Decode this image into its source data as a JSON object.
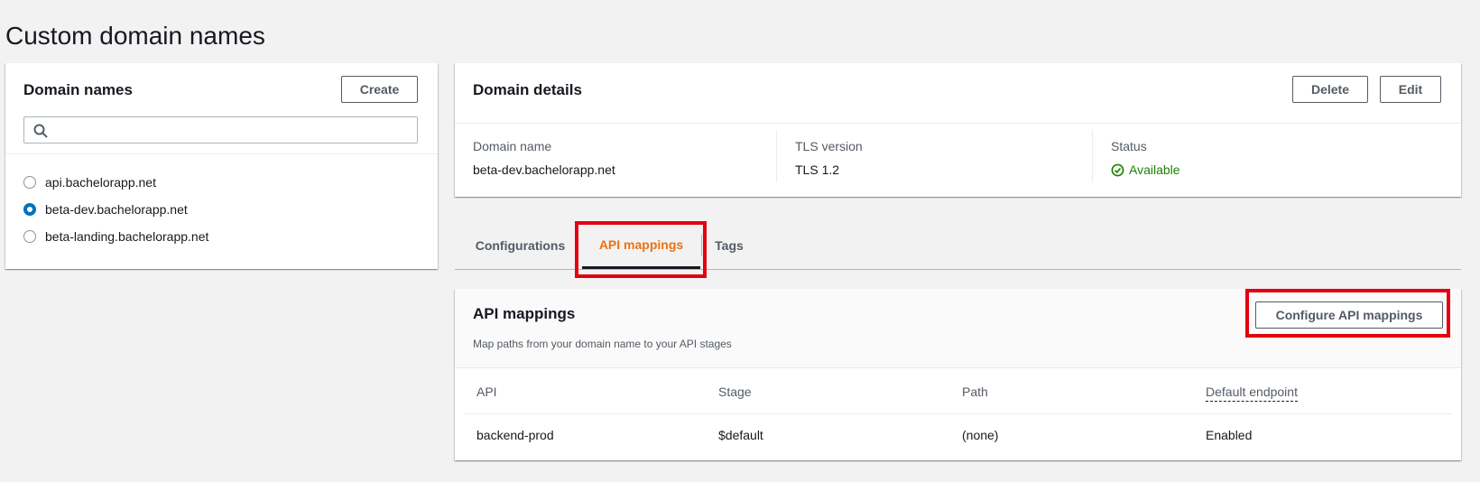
{
  "page": {
    "title": "Custom domain names"
  },
  "domain_names": {
    "heading": "Domain names",
    "create_label": "Create",
    "search_placeholder": "",
    "items": [
      {
        "label": "api.bachelorapp.net",
        "selected": false
      },
      {
        "label": "beta-dev.bachelorapp.net",
        "selected": true
      },
      {
        "label": "beta-landing.bachelorapp.net",
        "selected": false
      }
    ]
  },
  "details": {
    "heading": "Domain details",
    "delete_label": "Delete",
    "edit_label": "Edit",
    "domain_name_label": "Domain name",
    "domain_name_value": "beta-dev.bachelorapp.net",
    "tls_label": "TLS version",
    "tls_value": "TLS 1.2",
    "status_label": "Status",
    "status_value": "Available"
  },
  "tabs": [
    {
      "label": "Configurations",
      "active": false
    },
    {
      "label": "API mappings",
      "active": true
    },
    {
      "label": "Tags",
      "active": false
    }
  ],
  "mappings": {
    "heading": "API mappings",
    "description": "Map paths from your domain name to your API stages",
    "configure_label": "Configure API mappings",
    "columns": [
      "API",
      "Stage",
      "Path",
      "Default endpoint"
    ],
    "rows": [
      {
        "api": "backend-prod",
        "stage": "$default",
        "path": "(none)",
        "default_endpoint": "Enabled"
      }
    ]
  },
  "colors": {
    "accent": "#ec7211",
    "link": "#0073bb",
    "success": "#1d8102",
    "highlight": "#e3000f"
  },
  "icons": [
    "search-icon",
    "check-circle-icon"
  ]
}
